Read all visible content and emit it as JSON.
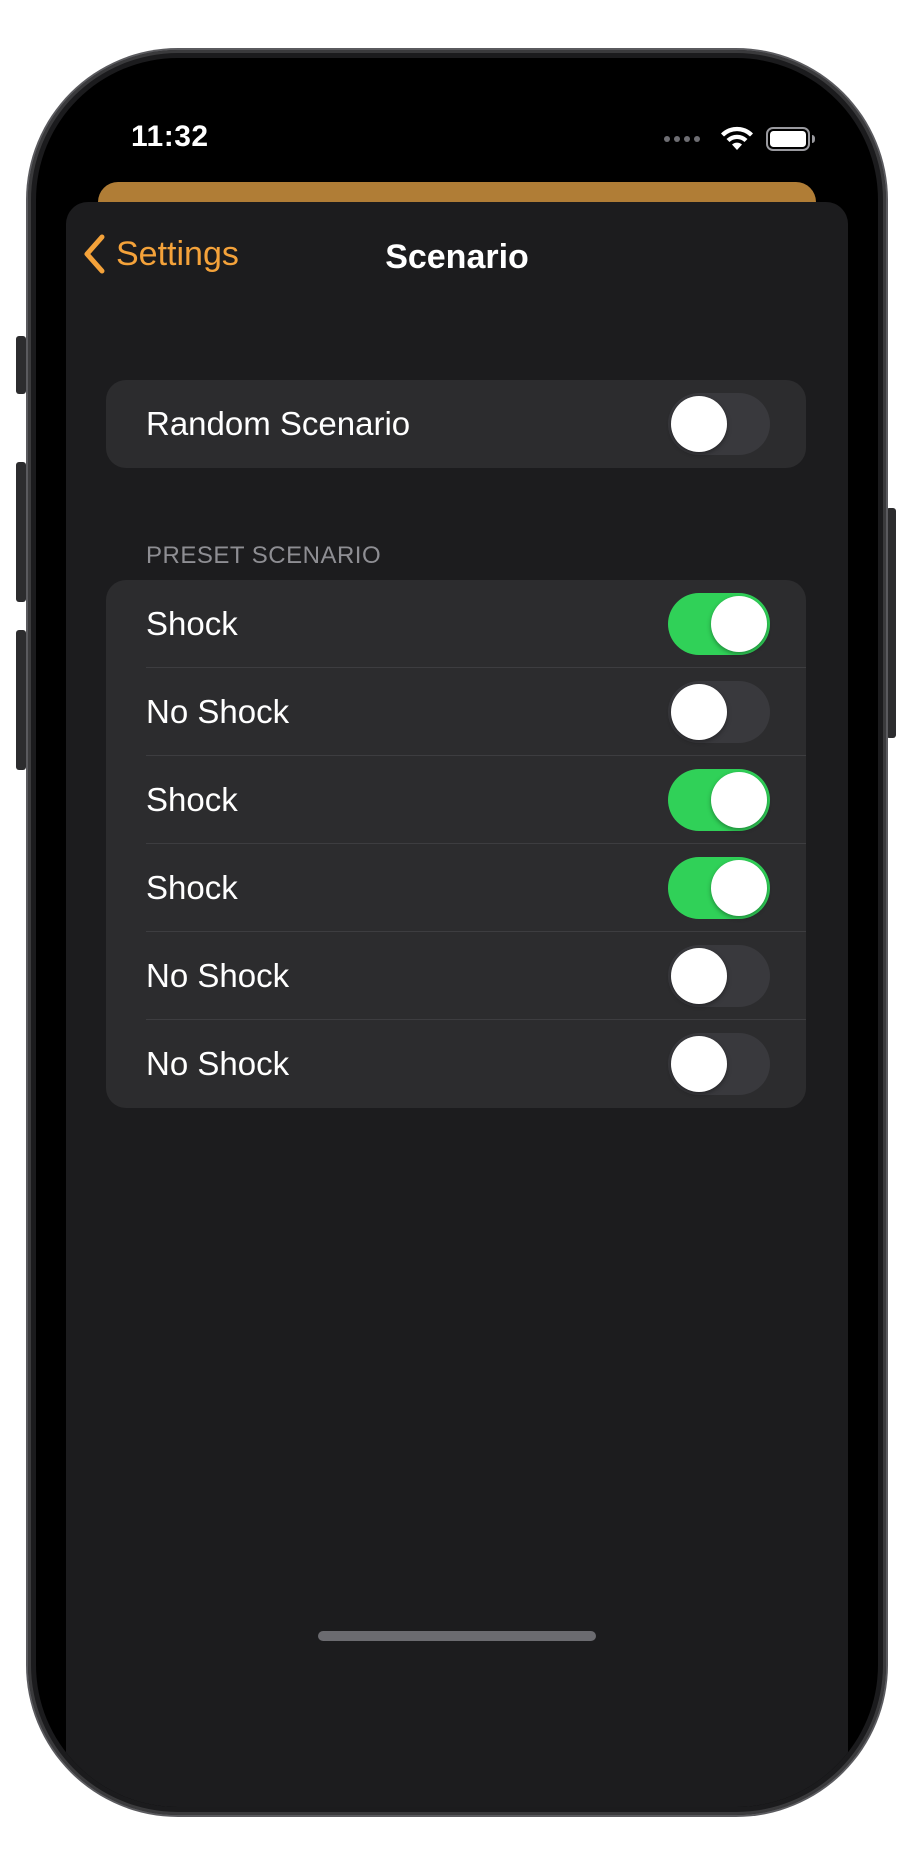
{
  "status_bar": {
    "time": "11:32"
  },
  "nav": {
    "back_label": "Settings",
    "title": "Scenario"
  },
  "random_group": {
    "label": "Random Scenario",
    "enabled": false
  },
  "preset_section": {
    "header": "PRESET SCENARIO",
    "items": [
      {
        "label": "Shock",
        "enabled": true
      },
      {
        "label": "No Shock",
        "enabled": false
      },
      {
        "label": "Shock",
        "enabled": true
      },
      {
        "label": "Shock",
        "enabled": true
      },
      {
        "label": "No Shock",
        "enabled": false
      },
      {
        "label": "No Shock",
        "enabled": false
      }
    ]
  },
  "colors": {
    "accent": "#f4a23a",
    "toggle_on": "#30d158",
    "toggle_off": "#39393d",
    "sheet_background": "#1c1c1e",
    "group_background": "#2c2c2e",
    "behind_sheet": "#b07d36"
  },
  "icons": {
    "back": "chevron-left-icon",
    "wifi": "wifi-icon",
    "battery": "battery-icon",
    "signal": "cellular-signal-icon"
  }
}
